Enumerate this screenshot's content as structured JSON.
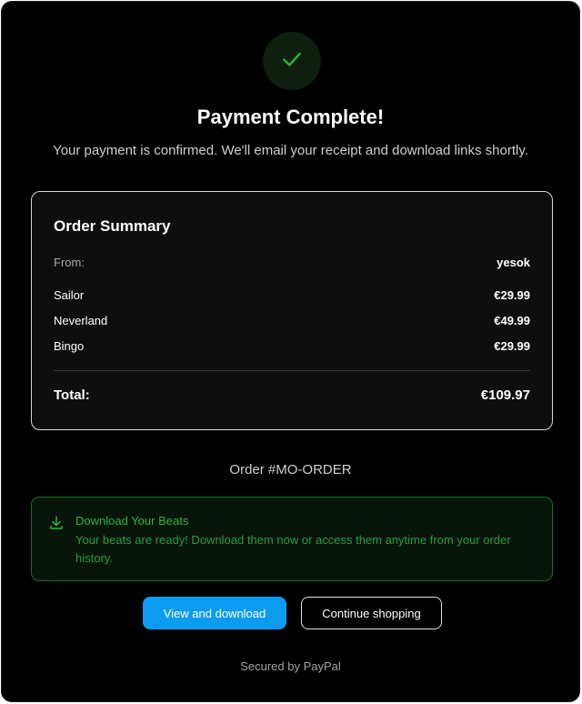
{
  "header": {
    "icon": "check-icon",
    "title": "Payment Complete!",
    "subtitle": "Your payment is confirmed. We'll email your receipt and download links shortly."
  },
  "summary": {
    "title": "Order Summary",
    "from_label": "From:",
    "from_value": "yesok",
    "items": [
      {
        "name": "Sailor",
        "price": "€29.99"
      },
      {
        "name": "Neverland",
        "price": "€49.99"
      },
      {
        "name": "Bingo",
        "price": "€29.99"
      }
    ],
    "total_label": "Total:",
    "total_value": "€109.97"
  },
  "order_id": "Order #MO-ORDER",
  "download": {
    "icon": "download-icon",
    "title": "Download Your Beats",
    "text": "Your beats are ready! Download them now or access them anytime from your order history."
  },
  "buttons": {
    "primary": "View and download",
    "secondary": "Continue shopping"
  },
  "footer": "Secured by PayPal",
  "colors": {
    "accent": "#0b9cf2",
    "success": "#2fb344",
    "background": "#000000"
  }
}
